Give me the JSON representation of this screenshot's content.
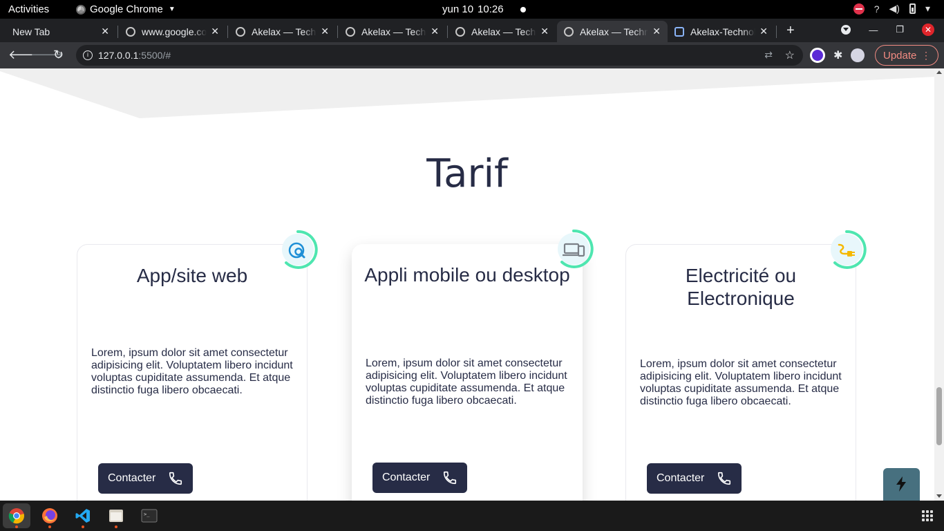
{
  "system_bar": {
    "activities": "Activities",
    "app_name": "Google Chrome",
    "date": "yun 10",
    "time": "10:26"
  },
  "tabs": [
    {
      "title": "New Tab",
      "favicon": "none"
    },
    {
      "title": "www.google.com",
      "favicon": "globe-icon"
    },
    {
      "title": "Akelax — Technologies",
      "favicon": "globe-icon"
    },
    {
      "title": "Akelax — Technologies",
      "favicon": "globe-icon"
    },
    {
      "title": "Akelax — Technologies",
      "favicon": "globe-icon"
    },
    {
      "title": "Akelax — Technologies",
      "favicon": "globe-icon",
      "active": true
    },
    {
      "title": "Akelax-Technologies",
      "favicon": "logo-icon"
    }
  ],
  "address_bar": {
    "host": "127.0.0.1",
    "rest": ":5500/#"
  },
  "toolbar": {
    "update_label": "Update"
  },
  "page": {
    "section_title": "Tarif",
    "cards": [
      {
        "title": "App/site web",
        "icon": "web-search-icon",
        "icon_color": "#1e8fd6",
        "text": "Lorem, ipsum dolor sit amet consectetur adipisicing elit. Voluptatem libero incidunt voluptas cupiditate assumenda. Et atque distinctio fuga libero obcaecati.",
        "button_label": "Contacter"
      },
      {
        "title": "Appli mobile ou desktop",
        "icon": "devices-icon",
        "icon_color": "#7a7f86",
        "text": "Lorem, ipsum dolor sit amet consectetur adipisicing elit. Voluptatem libero incidunt voluptas cupiditate assumenda. Et atque distinctio fuga libero obcaecati.",
        "button_label": "Contacter"
      },
      {
        "title": "Electricité ou Electronique",
        "icon": "plug-icon",
        "icon_color": "#f5b800",
        "text": "Lorem, ipsum dolor sit amet consectetur adipisicing elit. Voluptatem libero incidunt voluptas cupiditate assumenda. Et atque distinctio fuga libero obcaecati.",
        "button_label": "Contacter"
      }
    ]
  },
  "colors": {
    "primary_dark": "#272c46",
    "badge_ring": "#4ee6b0",
    "badge_fill": "#e8f7fb",
    "fab": "#47707f",
    "update_accent": "#f28b82"
  },
  "dock": {
    "apps": [
      "chrome-icon",
      "firefox-icon",
      "vscode-icon",
      "files-icon",
      "terminal-icon"
    ]
  }
}
